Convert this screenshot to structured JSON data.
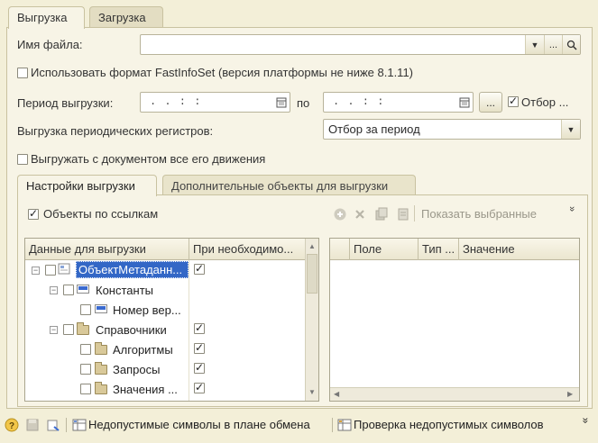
{
  "tabs": {
    "export": "Выгрузка",
    "import": "Загрузка"
  },
  "form": {
    "file_name_label": "Имя файла:",
    "file_name_value": "",
    "choose_button": "...",
    "search_button": "Q",
    "fastinfoset_label": "Использовать формат FastInfoSet (версия платформы не ниже 8.1.11)",
    "period_label": "Период выгрузки:",
    "period_from": ".  .    :  :",
    "period_to_label": "по",
    "period_to": ".  .    :  :",
    "period_dots_button": "...",
    "filter_label": "Отбор ...",
    "periodic_label": "Выгрузка периодических регистров:",
    "periodic_value": "Отбор за период",
    "movements_label": "Выгружать с документом все его движения"
  },
  "inner_tabs": {
    "settings": "Настройки выгрузки",
    "additional": "Дополнительные объекты для выгрузки"
  },
  "toolbar": {
    "ref_objects_label": "Объекты по ссылкам",
    "show_selected": "Показать выбранные",
    "more": "»"
  },
  "left_table": {
    "columns": [
      "Данные для выгрузки",
      "При необходимо..."
    ],
    "rows": [
      {
        "label": "ОбъектМетаданн...",
        "checked_any": true
      },
      {
        "label": "Константы",
        "checked_any": false
      },
      {
        "label": "Номер вер...",
        "checked_any": false
      },
      {
        "label": "Справочники",
        "checked_any": true
      },
      {
        "label": "Алгоритмы",
        "checked_any": true
      },
      {
        "label": "Запросы",
        "checked_any": true
      },
      {
        "label": "Значения ...",
        "checked_any": true
      }
    ]
  },
  "right_table": {
    "columns": [
      "Поле",
      "Тип ...",
      "Значение"
    ]
  },
  "status": {
    "invalid_symbols_plan": "Недопустимые символы в плане обмена",
    "check_invalid_symbols": "Проверка недопустимых символов"
  },
  "colors": {
    "background": "#f3efd8",
    "panel": "#f7f4e6",
    "selection": "#3367c6"
  }
}
